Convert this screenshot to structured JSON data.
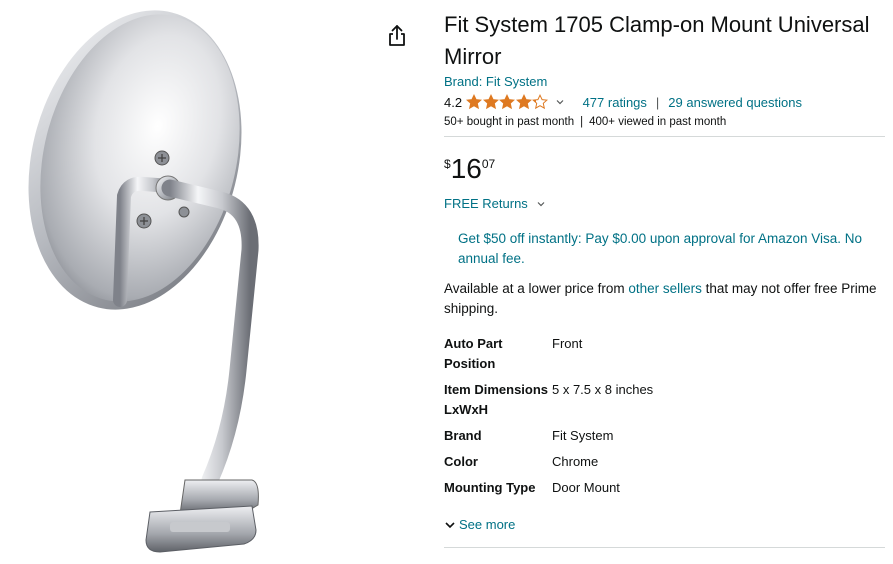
{
  "product": {
    "title": "Fit System 1705 Clamp-on Mount Universal Mirror",
    "brand_link": "Brand: Fit System",
    "rating_value": "4.2",
    "rating_stars": 4.2,
    "ratings_count": "477 ratings",
    "separator": "|",
    "answered_questions": "29 answered questions",
    "bought": "50+ bought in past month",
    "viewed": "400+ viewed in past month"
  },
  "price": {
    "currency": "$",
    "whole": "16",
    "fraction": "07"
  },
  "returns": "FREE Returns",
  "promo": "Get $50 off instantly: Pay $0.00 upon approval for Amazon Visa. No annual fee.",
  "sellers": {
    "prefix": "Available at a lower price from ",
    "link": "other sellers",
    "suffix": " that may not offer free Prime shipping."
  },
  "specs": [
    {
      "label": "Auto Part Position",
      "value": "Front"
    },
    {
      "label": "Item Dimensions LxWxH",
      "value": "5 x 7.5 x 8 inches"
    },
    {
      "label": "Brand",
      "value": "Fit System"
    },
    {
      "label": "Color",
      "value": "Chrome"
    },
    {
      "label": "Mounting Type",
      "value": "Door Mount"
    }
  ],
  "see_more": "See more",
  "icons": {
    "share": "share-icon",
    "star": "star-icon",
    "chevron": "chevron-down-icon"
  },
  "colors": {
    "link": "#007185",
    "star": "#de7921",
    "text": "#0f1111",
    "divider": "#d5d9d9"
  }
}
